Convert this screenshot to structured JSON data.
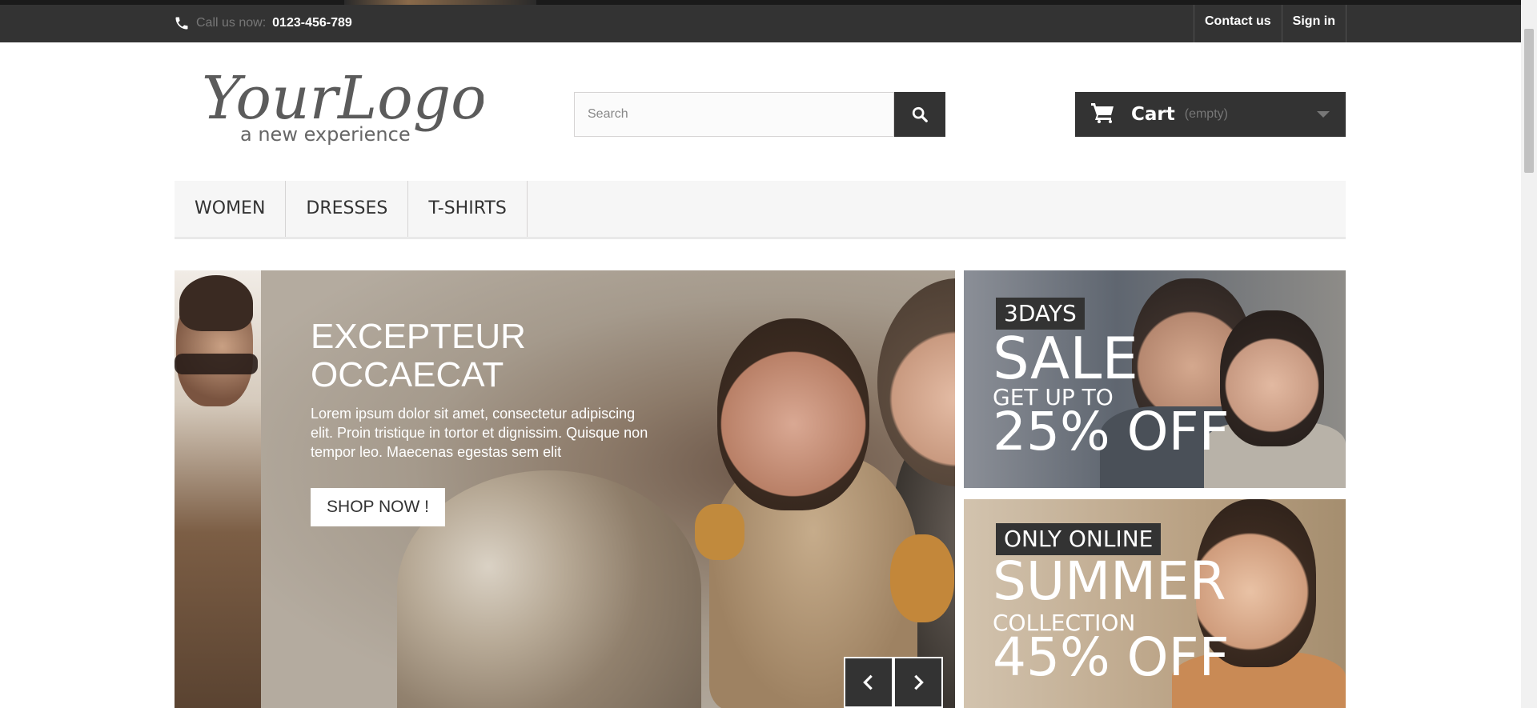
{
  "topbar": {
    "phone_prefix": "Call us now:",
    "phone_number": "0123-456-789",
    "links": [
      "Contact us",
      "Sign in"
    ]
  },
  "logo": {
    "title": "YourLogo",
    "tagline": "a new experience"
  },
  "search": {
    "placeholder": "Search",
    "icon": "search-icon"
  },
  "cart": {
    "label": "Cart",
    "status": "(empty)",
    "icon": "cart-icon"
  },
  "menu": {
    "items": [
      "WOMEN",
      "DRESSES",
      "T-SHIRTS"
    ]
  },
  "slider": {
    "title_line1": "EXCEPTEUR",
    "title_line2": "OCCAECAT",
    "text": "Lorem ipsum dolor sit amet, consectetur adipiscing elit. Proin tristique in tortor et dignissim. Quisque non tempor leo. Maecenas egestas sem elit",
    "button": "SHOP NOW !",
    "prev_icon": "chevron-left-icon",
    "next_icon": "chevron-right-icon"
  },
  "banners": {
    "b1": {
      "tag": "3DAYS",
      "line1": "SALE",
      "line2": "GET UP TO",
      "line3": "25% OFF"
    },
    "b2": {
      "tag": "ONLY ONLINE",
      "line1": "SUMMER",
      "line2": "COLLECTION",
      "line3": "45% OFF"
    }
  },
  "colors": {
    "dark": "#333333",
    "menu_bg": "#f6f6f6",
    "white": "#ffffff"
  }
}
